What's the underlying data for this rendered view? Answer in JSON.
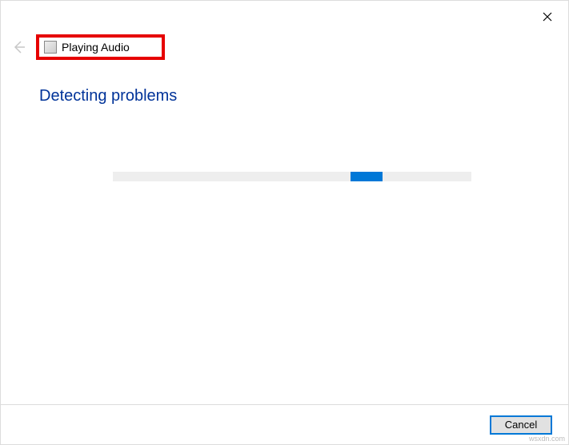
{
  "header": {
    "title": "Playing Audio"
  },
  "status": {
    "heading": "Detecting problems"
  },
  "footer": {
    "cancel_label": "Cancel"
  },
  "watermark": "wsxdn.com"
}
